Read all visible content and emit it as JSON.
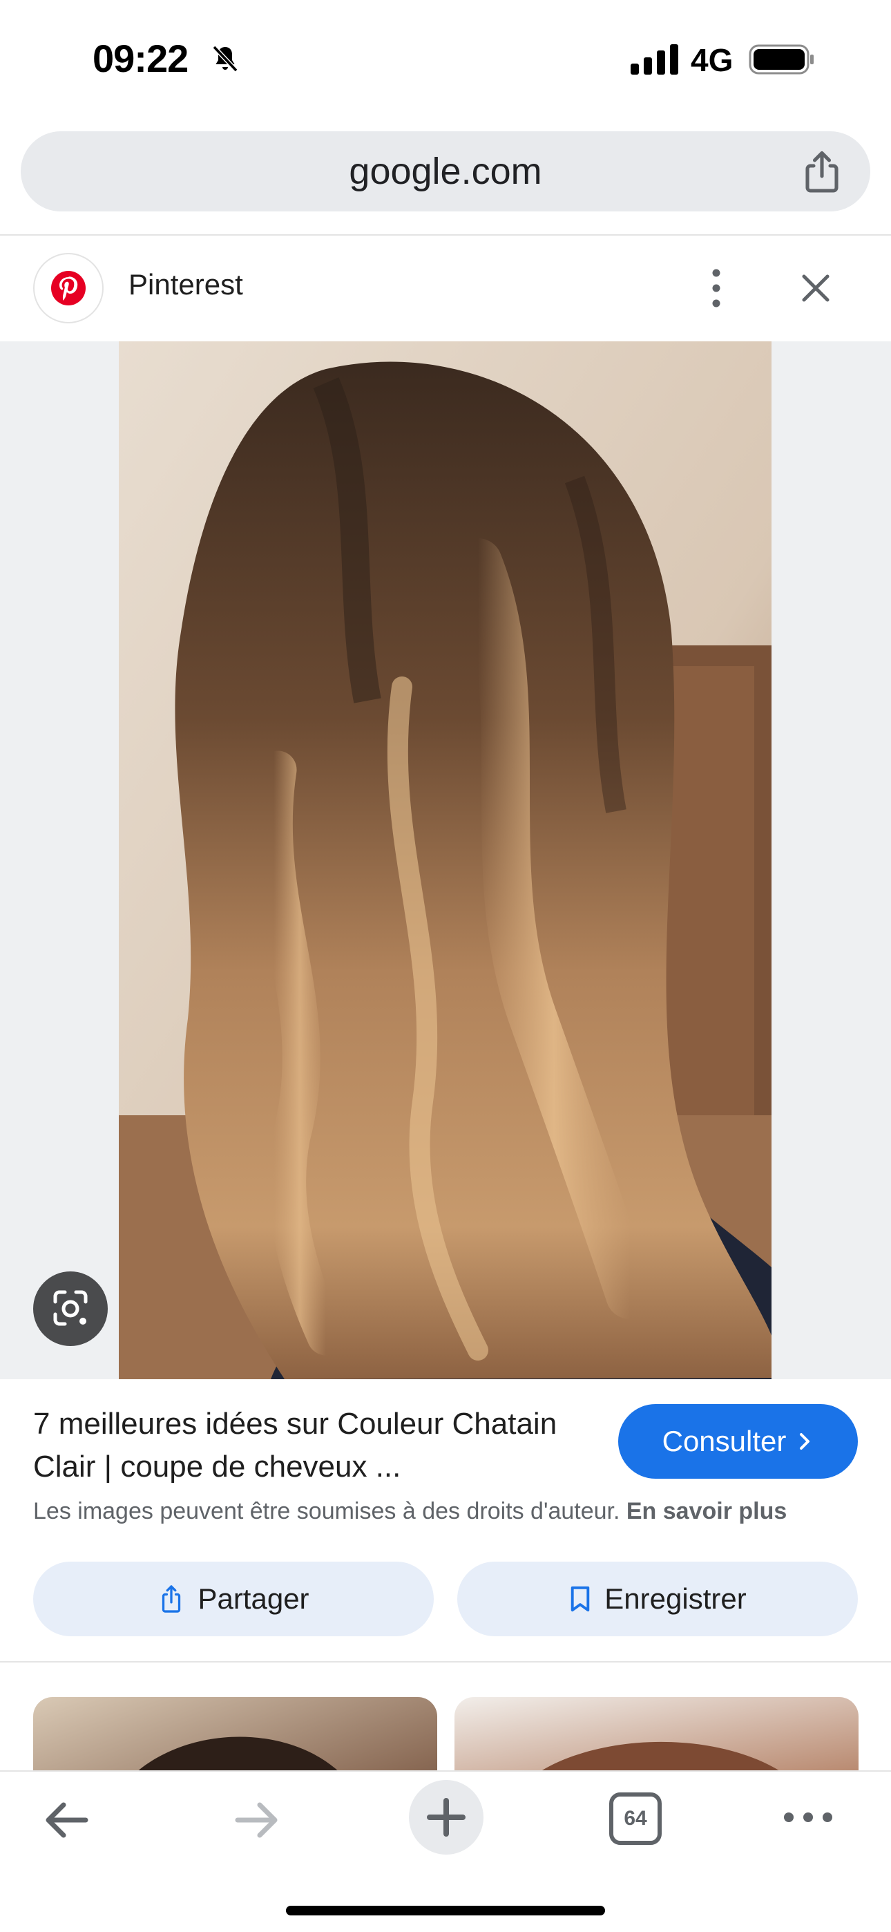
{
  "status_bar": {
    "time": "09:22",
    "network": "4G",
    "icons": [
      "bell-slash-icon",
      "signal-icon",
      "battery-icon"
    ]
  },
  "browser": {
    "url": "google.com",
    "share_icon": "share-icon"
  },
  "source": {
    "name": "Pinterest",
    "logo_icon": "pinterest-logo-icon",
    "brand_color": "#e60023"
  },
  "result": {
    "title": "7 meilleures idées sur Couleur Chatain Clair | coupe de cheveux ...",
    "visit_label": "Consulter",
    "copyright_text": "Les images peuvent être soumises à des droits d'auteur.",
    "learn_more": "En savoir plus",
    "share_label": "Partager",
    "save_label": "Enregistrer"
  },
  "toolbar": {
    "tab_count": "64"
  },
  "colors": {
    "accent": "#1a73e8",
    "pill_bg": "#e7eef9",
    "url_bar_bg": "#e8eaed"
  }
}
